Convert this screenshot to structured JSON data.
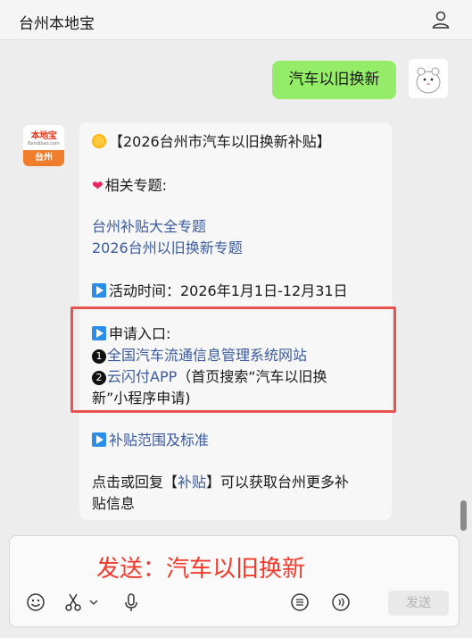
{
  "header": {
    "title": "台州本地宝",
    "person_icon": "person-icon"
  },
  "user_message": {
    "text": "汽车以旧换新"
  },
  "bot": {
    "avatar": {
      "brand": "本地宝",
      "sub": "Bendibao.com",
      "city": "台州"
    },
    "title_line": "【2026台州市汽车以旧换新补贴】",
    "related_label": "相关专题:",
    "links": [
      "台州补贴大全专题",
      "2026台州以旧换新专题"
    ],
    "activity_time": "活动时间：2026年1月1日-12月31日",
    "apply_label": "申请入口:",
    "entry1_num": "1",
    "entry1_link": "全国汽车流通信息管理系统网站",
    "entry2_num": "2",
    "entry2_link": "云闪付APP",
    "entry2_rest": "（首页搜索“汽车以旧换",
    "entry2_rest2": "新”小程序申请)",
    "subsidy_link": "补贴范围及标准",
    "footer_pre": "点击或回复【",
    "footer_link": "补贴",
    "footer_post": "】可以获取台州更多补",
    "footer_line2": "贴信息"
  },
  "input": {
    "value": "发送：汽车以旧换新",
    "send_label": "发送"
  },
  "colors": {
    "user_bubble": "#95ec69",
    "link": "#3b5b9e",
    "highlight_box": "#e9534f",
    "input_text": "#f23b2c"
  }
}
